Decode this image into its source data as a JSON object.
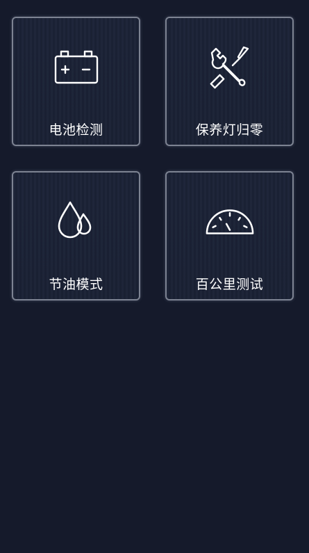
{
  "tiles": [
    {
      "label": "电池检测",
      "icon": "battery-icon"
    },
    {
      "label": "保养灯归零",
      "icon": "wrench-screwdriver-icon"
    },
    {
      "label": "节油模式",
      "icon": "fuel-drops-icon"
    },
    {
      "label": "百公里测试",
      "icon": "speedometer-icon"
    }
  ],
  "colors": {
    "background": "#151a2b",
    "tile_border": "#7d8392",
    "text": "#ffffff"
  }
}
